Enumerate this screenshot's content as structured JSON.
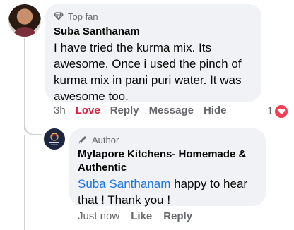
{
  "comment": {
    "badge": "Top fan",
    "badge_icon": "diamond-icon",
    "author": "Suba Santhanam",
    "text": "I have tried the kurma mix. Its awesome. Once i used the pinch of kurma mix in pani puri water. It was awesome too.",
    "actions": {
      "time": "3h",
      "love": "Love",
      "reply": "Reply",
      "message": "Message",
      "hide": "Hide"
    },
    "reaction": {
      "count": "1",
      "type": "heart-icon",
      "color": "#f33e58"
    }
  },
  "reply": {
    "badge": "Author",
    "badge_icon": "pen-icon",
    "author": "Mylapore Kitchens- Homemade & Authentic",
    "mention": "Suba Santhanam",
    "text": " happy to hear that ! Thank you !",
    "actions": {
      "time": "Just now",
      "like": "Like",
      "reply": "Reply"
    }
  },
  "colors": {
    "love": "#e41e3f",
    "mention": "#1b74e4",
    "bubble": "#f0f2f5",
    "secondary_text": "#65676b"
  }
}
